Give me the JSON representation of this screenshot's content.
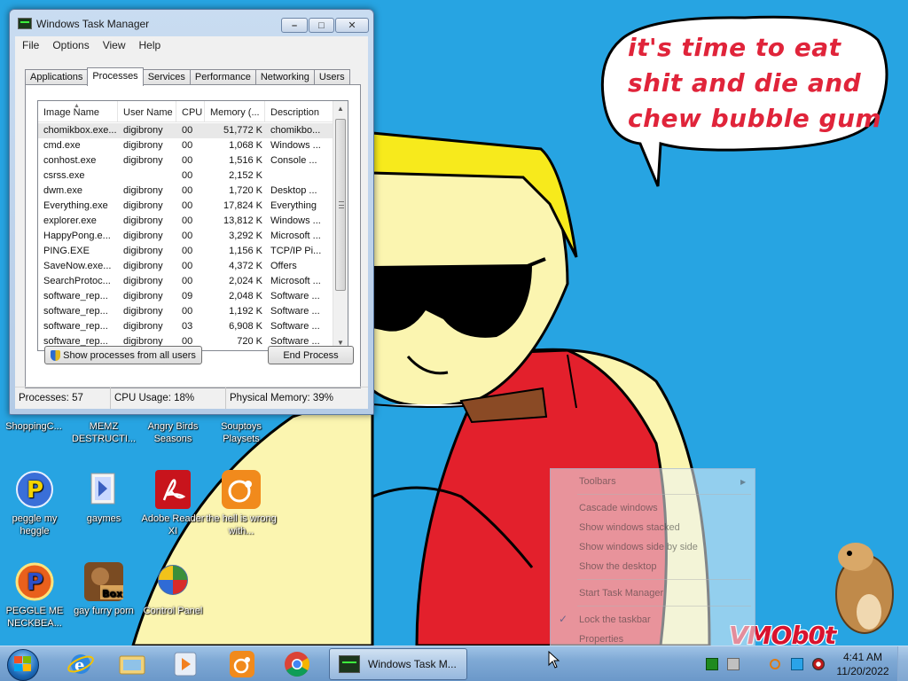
{
  "speech_text": "it's time to eat shit and die and chew bubble gum",
  "watermark": "VMOb0t",
  "task_manager": {
    "title": "Windows Task Manager",
    "window_controls": {
      "minimize": "–",
      "maximize": "□",
      "close": "✕"
    },
    "menu": [
      "File",
      "Options",
      "View",
      "Help"
    ],
    "tabs": [
      "Applications",
      "Processes",
      "Services",
      "Performance",
      "Networking",
      "Users"
    ],
    "active_tab": "Processes",
    "columns": [
      "Image Name",
      "User Name",
      "CPU",
      "Memory (...",
      "Description"
    ],
    "rows": [
      [
        "chomikbox.exe...",
        "digibrony",
        "00",
        "51,772 K",
        "chomikbo..."
      ],
      [
        "cmd.exe",
        "digibrony",
        "00",
        "1,068 K",
        "Windows ..."
      ],
      [
        "conhost.exe",
        "digibrony",
        "00",
        "1,516 K",
        "Console ..."
      ],
      [
        "csrss.exe",
        "",
        "00",
        "2,152 K",
        ""
      ],
      [
        "dwm.exe",
        "digibrony",
        "00",
        "1,720 K",
        "Desktop ..."
      ],
      [
        "Everything.exe",
        "digibrony",
        "00",
        "17,824 K",
        "Everything"
      ],
      [
        "explorer.exe",
        "digibrony",
        "00",
        "13,812 K",
        "Windows ..."
      ],
      [
        "HappyPong.e...",
        "digibrony",
        "00",
        "3,292 K",
        "Microsoft ..."
      ],
      [
        "PING.EXE",
        "digibrony",
        "00",
        "1,156 K",
        "TCP/IP Pi..."
      ],
      [
        "SaveNow.exe...",
        "digibrony",
        "00",
        "4,372 K",
        "Offers"
      ],
      [
        "SearchProtoc...",
        "digibrony",
        "00",
        "2,024 K",
        "Microsoft ..."
      ],
      [
        "software_rep...",
        "digibrony",
        "09",
        "2,048 K",
        "Software ..."
      ],
      [
        "software_rep...",
        "digibrony",
        "00",
        "1,192 K",
        "Software ..."
      ],
      [
        "software_rep...",
        "digibrony",
        "03",
        "6,908 K",
        "Software ..."
      ],
      [
        "software_rep...",
        "digibrony",
        "00",
        "720 K",
        "Software ..."
      ]
    ],
    "show_all_button": "Show processes from all users",
    "end_process_button": "End Process",
    "status": {
      "processes": "Processes: 57",
      "cpu": "CPU Usage: 18%",
      "memory": "Physical Memory: 39%"
    }
  },
  "desktop_icons": [
    {
      "label": "ShoppingC...",
      "icon": "shopping-icon"
    },
    {
      "label": "MEMZ DESTRUCTI...",
      "icon": "memz-icon"
    },
    {
      "label": "Angry Birds Seasons",
      "icon": "angry-birds-icon"
    },
    {
      "label": "Souptoys Playsets",
      "icon": "souptoys-icon"
    },
    {
      "label": "peggle my heggle",
      "icon": "peggle-icon"
    },
    {
      "label": "gaymes",
      "icon": "games-folder-icon"
    },
    {
      "label": "Adobe Reader XI",
      "icon": "adobe-reader-icon"
    },
    {
      "label": "the hell is wrong with...",
      "icon": "uc-browser-icon"
    },
    {
      "label": "PEGGLE ME NECKBEA...",
      "icon": "peggle-icon"
    },
    {
      "label": "gay furry porn",
      "icon": "bonzi-box-icon"
    },
    {
      "label": "Control Panel",
      "icon": "control-panel-icon"
    }
  ],
  "context_menu": {
    "items": [
      "Toolbars",
      "Cascade windows",
      "Show windows stacked",
      "Show windows side by side",
      "Show the desktop",
      "Start Task Manager",
      "Lock the taskbar",
      "Properties"
    ]
  },
  "taskbar": {
    "pinned": [
      "internet-explorer-icon",
      "windows-explorer-icon",
      "media-player-icon",
      "uc-browser-icon",
      "chrome-icon"
    ],
    "active_window": "Windows Task M...",
    "clock_time": "4:41 AM",
    "clock_date": "11/20/2022"
  },
  "colors": {
    "wallpaper": "#27a4e2",
    "speech": "#e0243a",
    "hair": "#f7ea1c",
    "skin": "#fbf5b0",
    "shirt": "#e3202c"
  }
}
